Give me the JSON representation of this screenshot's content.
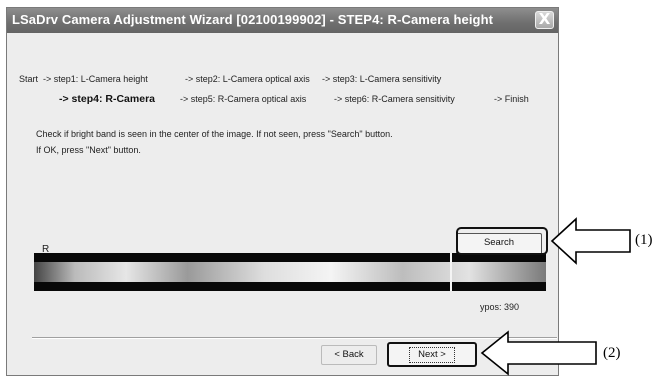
{
  "window": {
    "title": "LSaDrv Camera Adjustment Wizard [02100199902] - STEP4: R-Camera height",
    "close_glyph": "X"
  },
  "steps": {
    "start": "Start",
    "step1": "-> step1: L-Camera height",
    "step2": "-> step2: L-Camera optical axis",
    "step3": "-> step3: L-Camera sensitivity",
    "step4": "-> step4: R-Camera",
    "step5": "-> step5: R-Camera optical axis",
    "step6": "-> step6: R-Camera sensitivity",
    "finish": "-> Finish"
  },
  "instructions": {
    "line1": "Check if bright band is seen in the center of the image. If not seen, press \"Search\" button.",
    "line2": "If OK, press \"Next\" button."
  },
  "image_panel": {
    "label": "R",
    "ypos_text": "ypos:  390"
  },
  "buttons": {
    "search": "Search",
    "back": "< Back",
    "next": "Next >"
  },
  "callouts": {
    "one": "(1)",
    "two": "(2)"
  },
  "icons": [
    "close-icon",
    "left-arrow-icon"
  ]
}
